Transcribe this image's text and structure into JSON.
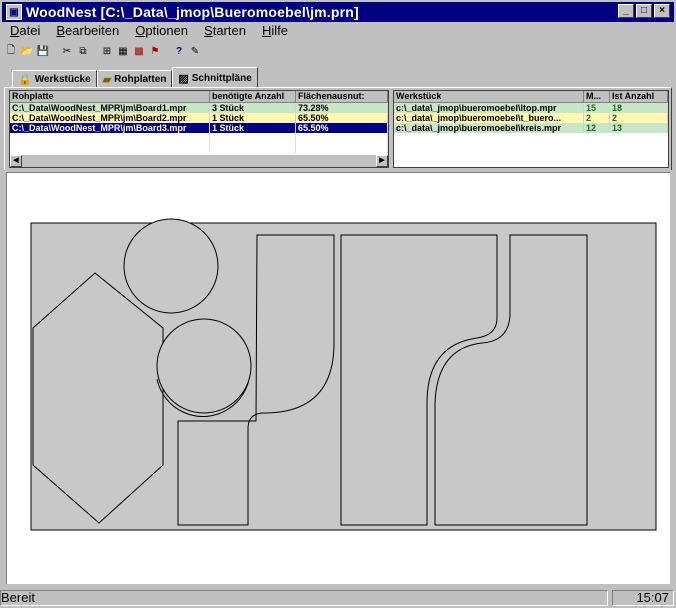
{
  "window": {
    "title": "WoodNest [C:\\_Data\\_jmop\\Bueromoebel\\jm.prn]",
    "app_icon": "woodnest-app-icon"
  },
  "window_buttons": {
    "minimize": "_",
    "maximize": "□",
    "close": "×"
  },
  "menu": [
    {
      "pre": "",
      "ul": "D",
      "post": "atei"
    },
    {
      "pre": "",
      "ul": "B",
      "post": "earbeiten"
    },
    {
      "pre": "",
      "ul": "O",
      "post": "ptionen"
    },
    {
      "pre": "",
      "ul": "S",
      "post": "tarten"
    },
    {
      "pre": "",
      "ul": "H",
      "post": "ilfe"
    }
  ],
  "toolbar": [
    {
      "icon": "new-file-icon",
      "glyph": "🗋"
    },
    {
      "icon": "open-folder-icon",
      "glyph": "📂"
    },
    {
      "icon": "save-icon",
      "glyph": "💾"
    },
    {
      "icon": "cut-icon",
      "glyph": "✂"
    },
    {
      "icon": "copy-icon",
      "glyph": "⧉"
    },
    {
      "icon": "tree-icon",
      "glyph": "⊞"
    },
    {
      "icon": "layout-icon",
      "glyph": "▦"
    },
    {
      "icon": "color-icon",
      "glyph": "▩"
    },
    {
      "icon": "flag-icon",
      "glyph": "⚑"
    },
    {
      "icon": "help-icon",
      "glyph": "?"
    },
    {
      "icon": "context-help-icon",
      "glyph": "✎"
    }
  ],
  "tabs": [
    {
      "label": "Werkstücke",
      "icon": "workpiece-icon",
      "glyph": "🔒"
    },
    {
      "label": "Rohplatten",
      "icon": "boards-icon",
      "glyph": "▰"
    },
    {
      "label": "Schnittpläne",
      "icon": "cutting-plan-icon",
      "glyph": "▨",
      "active": true
    }
  ],
  "left_table": {
    "headers": [
      "Rohplatte",
      "benötigte Anzahl",
      "Flächenausnut:"
    ],
    "rows": [
      [
        "C:\\_Data\\WoodNest_MPR\\jm\\Board1.mpr",
        "3 Stück",
        "73.28%"
      ],
      [
        "C:\\_Data\\WoodNest_MPR\\jm\\Board2.mpr",
        "1 Stück",
        "65.50%"
      ],
      [
        "C:\\_Data\\WoodNest_MPR\\jm\\Board3.mpr",
        "1 Stück",
        "65.50%"
      ]
    ]
  },
  "right_table": {
    "headers": [
      "Werkstück",
      "M...",
      "Ist Anzahl"
    ],
    "rows": [
      [
        "c:\\_data\\_jmop\\bueromoebel\\ltop.mpr",
        "15",
        "18"
      ],
      [
        "c:\\_data\\_jmop\\bueromoebel\\t_buero...",
        "2",
        "2"
      ],
      [
        "c:\\_data\\_jmop\\bueromoebel\\kreis.mpr",
        "12",
        "13"
      ]
    ]
  },
  "colors": {
    "title_bar": "#000080",
    "row_green": "#c8e6c8",
    "row_yellow": "#fff7b0",
    "row_selected": "#000080",
    "board_fill": "#c8c8c8"
  },
  "status": {
    "text": "Bereit",
    "time": "15:07"
  }
}
